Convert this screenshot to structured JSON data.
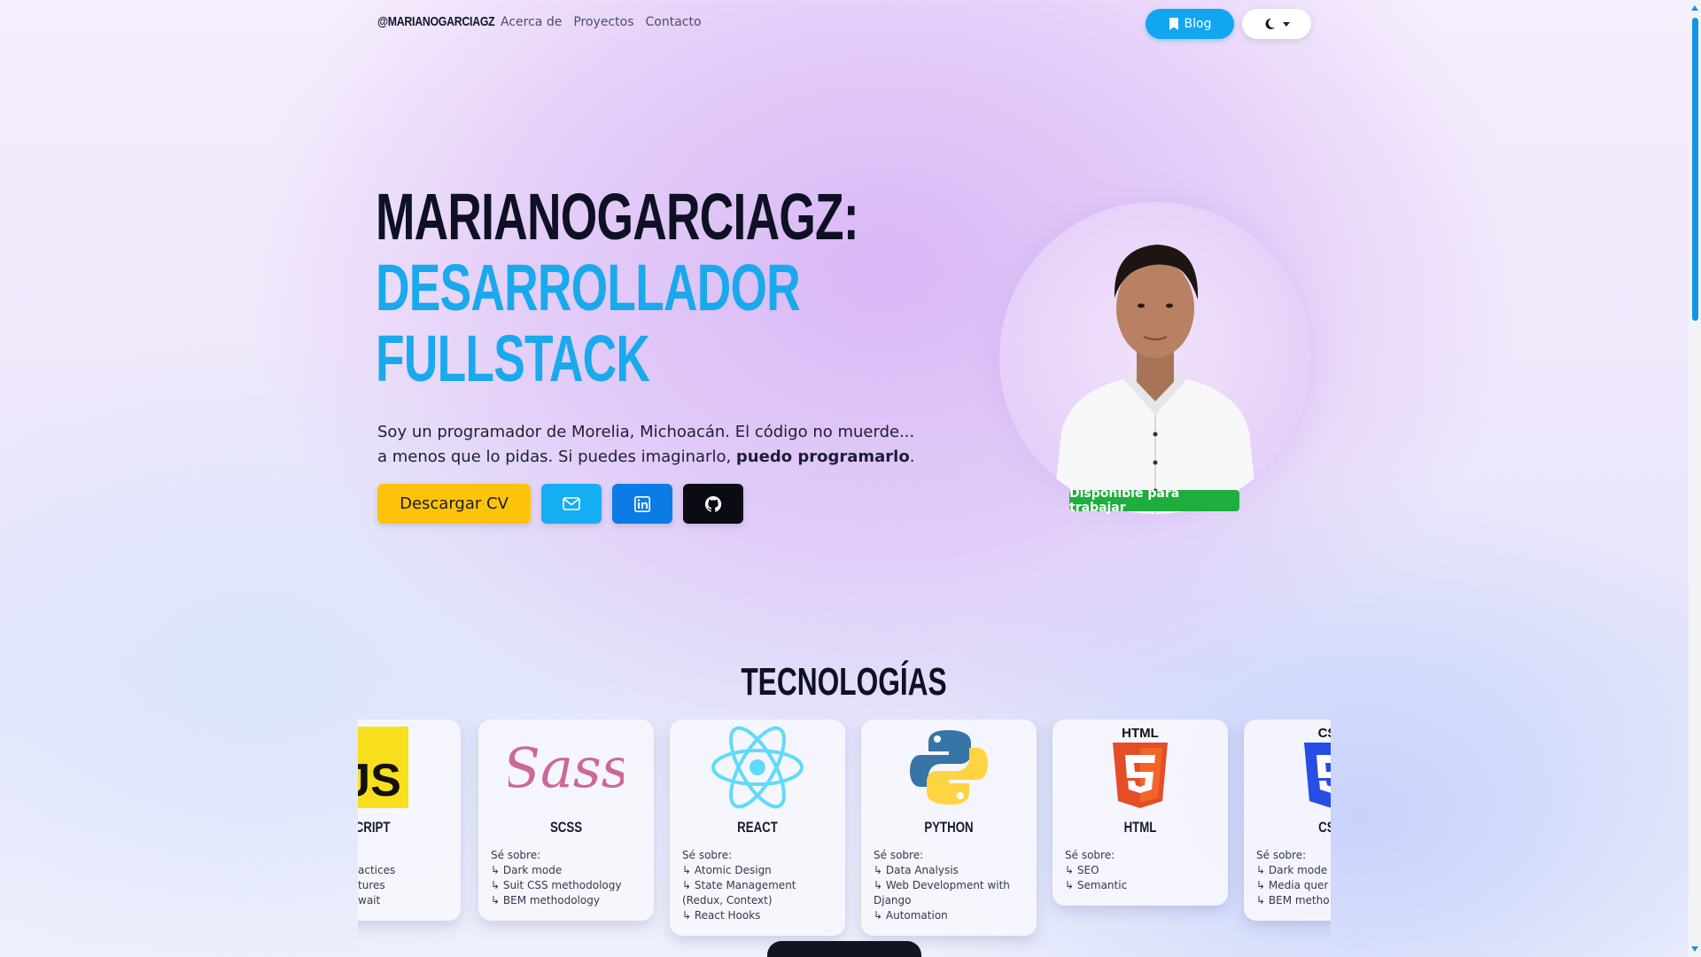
{
  "nav": {
    "brand": "@MARIANOGARCIAGZ",
    "links": [
      "Acerca de",
      "Proyectos",
      "Contacto"
    ],
    "blog_label": "Blog",
    "blog_icon": "bookmark-icon",
    "theme_icon": "moon-icon"
  },
  "hero": {
    "title_line1": "MARIANOGARCIAGZ:",
    "title_line2": "DESARROLLADOR",
    "title_line3": "FULLSTACK",
    "desc_part1": "Soy un programador de Morelia, Michoacán. El código no muerde... a menos que lo pidas. Si puedes imaginarlo, ",
    "desc_bold": "puedo programarlo",
    "desc_end": ".",
    "cv_label": "Descargar CV",
    "badge": "Disponible para trabajar"
  },
  "colors": {
    "accent": "#19a9ec",
    "cv_button": "#fdc30b",
    "badge": "#1fae3d",
    "linkedin": "#0b7ce6",
    "github": "#0b0b14"
  },
  "tech": {
    "title": "TECNOLOGÍAS",
    "cards": [
      {
        "name": "JAVASCRIPT",
        "label_visible": "VASCRIPT",
        "know": "",
        "items": [
          "actices",
          "tures",
          "wait"
        ]
      },
      {
        "name": "SCSS",
        "know": "Sé sobre:",
        "items": [
          "Dark mode",
          "Suit CSS methodology",
          "BEM methodology"
        ]
      },
      {
        "name": "REACT",
        "know": "Sé sobre:",
        "items": [
          "Atomic Design",
          "State Management (Redux, Context)",
          "React Hooks"
        ]
      },
      {
        "name": "PYTHON",
        "know": "Sé sobre:",
        "items": [
          "Data Analysis",
          "Web Development with Django",
          "Automation"
        ]
      },
      {
        "name": "HTML",
        "know": "Sé sobre:",
        "items": [
          "SEO",
          "Semantic"
        ]
      },
      {
        "name": "CSS",
        "label_visible": "CS",
        "know": "Sé sobre:",
        "items": [
          "Dark mode",
          "Media quer",
          "BEM metho"
        ]
      }
    ]
  }
}
